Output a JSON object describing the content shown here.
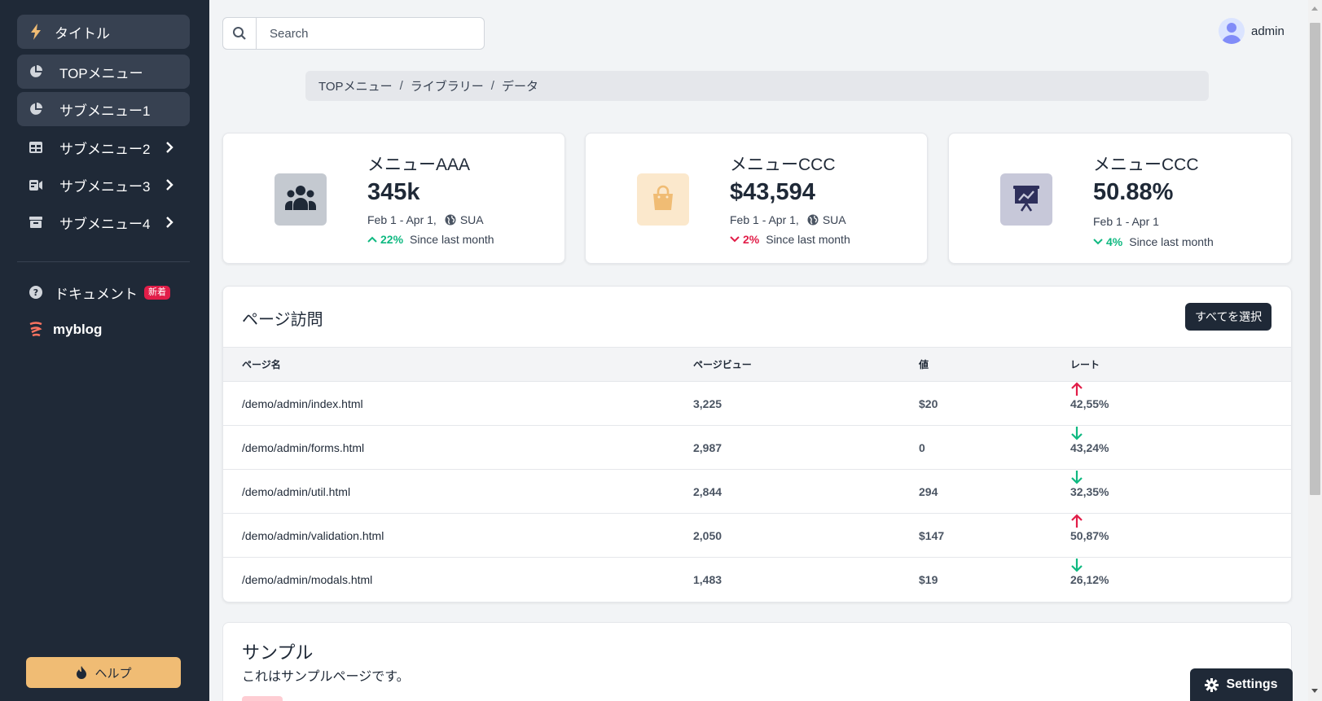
{
  "sidebar": {
    "brand": {
      "label": "タイトル",
      "icon": "lightning-icon"
    },
    "items": [
      {
        "label": "TOPメニュー",
        "icon": "pie-chart-icon",
        "active": true
      },
      {
        "label": "サブメニュー1",
        "icon": "pie-chart-icon",
        "active": true
      },
      {
        "label": "サブメニュー2",
        "icon": "table-icon",
        "has_children": true
      },
      {
        "label": "サブメニュー3",
        "icon": "presentation-icon",
        "has_children": true
      },
      {
        "label": "サブメニュー4",
        "icon": "archive-icon",
        "has_children": true
      }
    ],
    "docs": {
      "label": "ドキュメント",
      "badge": "新着",
      "icon": "question-circle-icon"
    },
    "blog": {
      "label": "myblog",
      "icon": "blog-logo-icon"
    },
    "help_button": {
      "label": "ヘルプ",
      "icon": "fire-icon"
    }
  },
  "topbar": {
    "search": {
      "placeholder": "Search",
      "value": ""
    },
    "user": {
      "name": "admin"
    }
  },
  "breadcrumb": [
    "TOPメニュー",
    "ライブラリー",
    "データ"
  ],
  "stats": [
    {
      "title": "メニューAAA",
      "value": "345k",
      "date": "Feb 1 - Apr 1,",
      "region": "SUA",
      "change": "22%",
      "direction": "up",
      "change_label": "Since last month",
      "icon": "users-icon",
      "icon_bg": "#c4c9d0"
    },
    {
      "title": "メニューCCC",
      "value": "$43,594",
      "date": "Feb 1 - Apr 1,",
      "region": "SUA",
      "change": "2%",
      "direction": "down",
      "change_label": "Since last month",
      "icon": "shopping-bag-icon",
      "icon_bg": "#fbe8cc"
    },
    {
      "title": "メニューCCC",
      "value": "50.88%",
      "date": "Feb 1 - Apr 1",
      "region": "",
      "change": "4%",
      "direction": "up",
      "change_label": "Since last month",
      "icon": "presentation-chart-icon",
      "icon_bg": "#c7c8d9"
    }
  ],
  "page_visits": {
    "title": "ページ訪問",
    "select_all_label": "すべてを選択",
    "columns": [
      "ページ名",
      "ページビュー",
      "値",
      "レート"
    ],
    "rows": [
      {
        "page": "/demo/admin/index.html",
        "views": "3,225",
        "value": "$20",
        "rate": "42,55%",
        "direction": "up"
      },
      {
        "page": "/demo/admin/forms.html",
        "views": "2,987",
        "value": "0",
        "rate": "43,24%",
        "direction": "down"
      },
      {
        "page": "/demo/admin/util.html",
        "views": "2,844",
        "value": "294",
        "rate": "32,35%",
        "direction": "down"
      },
      {
        "page": "/demo/admin/validation.html",
        "views": "2,050",
        "value": "$147",
        "rate": "50,87%",
        "direction": "up"
      },
      {
        "page": "/demo/admin/modals.html",
        "views": "1,483",
        "value": "$19",
        "rate": "26,12%",
        "direction": "down"
      }
    ]
  },
  "sample": {
    "title": "サンプル",
    "description": "これはサンプルページです。"
  },
  "settings_button": {
    "label": "Settings",
    "icon": "gear-icon"
  },
  "colors": {
    "sidebar_bg": "#1f2937",
    "accent_up": "#10b981",
    "accent_down": "#e11d48",
    "help_bg": "#f0bc74"
  }
}
